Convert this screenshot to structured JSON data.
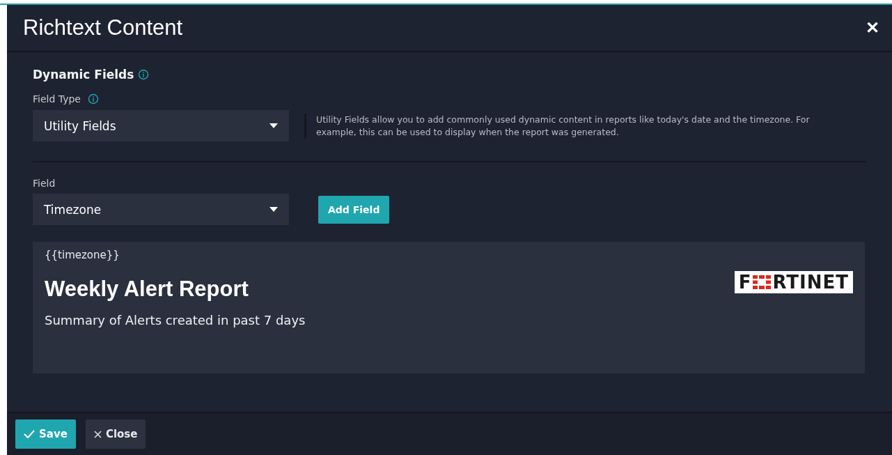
{
  "dialog": {
    "title": "Richtext Content",
    "close": "✕"
  },
  "section": {
    "title": "Dynamic Fields"
  },
  "field_type": {
    "label": "Field Type",
    "value": "Utility Fields",
    "help": "Utility Fields allow you to add commonly used dynamic content in reports like today's date and the timezone. For example, this can be used to display when the report was generated."
  },
  "field": {
    "label": "Field",
    "value": "Timezone",
    "button": "Add Field"
  },
  "editor": {
    "placeholder_tag": "{{timezone}}",
    "heading": "Weekly Alert Report",
    "subtitle": "Summary of Alerts created in past 7 days",
    "logo": {
      "text_start": "F",
      "text_end": "RTINET"
    }
  },
  "buttons": [
    {
      "kind": "primary",
      "label": "Save"
    },
    {
      "kind": "secondary",
      "label": "Close"
    }
  ]
}
